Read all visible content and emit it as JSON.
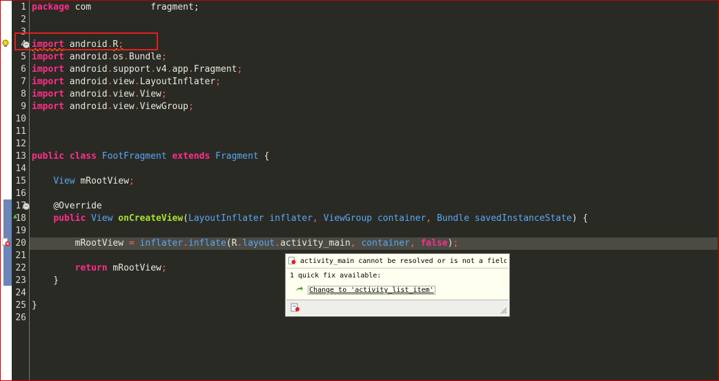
{
  "editor": {
    "lines": [
      {
        "n": "1",
        "t": [
          [
            "kw",
            "package"
          ],
          [
            "pn",
            " com"
          ],
          [
            "pn",
            "           "
          ],
          [
            "pn",
            "fragment;"
          ]
        ]
      },
      {
        "n": "2",
        "t": []
      },
      {
        "n": "3",
        "t": []
      },
      {
        "n": "4",
        "t": [
          [
            "kw",
            "import"
          ],
          [
            "pn",
            " android"
          ],
          [
            "dot",
            "."
          ],
          [
            "pn",
            "R"
          ],
          [
            "dot",
            ";"
          ]
        ]
      },
      {
        "n": "5",
        "t": [
          [
            "kw",
            "import"
          ],
          [
            "pn",
            " android"
          ],
          [
            "dot",
            "."
          ],
          [
            "pn",
            "os"
          ],
          [
            "dot",
            "."
          ],
          [
            "pn",
            "Bundle"
          ],
          [
            "dot",
            ";"
          ]
        ]
      },
      {
        "n": "6",
        "t": [
          [
            "kw",
            "import"
          ],
          [
            "pn",
            " android"
          ],
          [
            "dot",
            "."
          ],
          [
            "pn",
            "support"
          ],
          [
            "dot",
            "."
          ],
          [
            "pn",
            "v4"
          ],
          [
            "dot",
            "."
          ],
          [
            "pn",
            "app"
          ],
          [
            "dot",
            "."
          ],
          [
            "pn",
            "Fragment"
          ],
          [
            "dot",
            ";"
          ]
        ]
      },
      {
        "n": "7",
        "t": [
          [
            "kw",
            "import"
          ],
          [
            "pn",
            " android"
          ],
          [
            "dot",
            "."
          ],
          [
            "pn",
            "view"
          ],
          [
            "dot",
            "."
          ],
          [
            "pn",
            "LayoutInflater"
          ],
          [
            "dot",
            ";"
          ]
        ]
      },
      {
        "n": "8",
        "t": [
          [
            "kw",
            "import"
          ],
          [
            "pn",
            " android"
          ],
          [
            "dot",
            "."
          ],
          [
            "pn",
            "view"
          ],
          [
            "dot",
            "."
          ],
          [
            "pn",
            "View"
          ],
          [
            "dot",
            ";"
          ]
        ]
      },
      {
        "n": "9",
        "t": [
          [
            "kw",
            "import"
          ],
          [
            "pn",
            " android"
          ],
          [
            "dot",
            "."
          ],
          [
            "pn",
            "view"
          ],
          [
            "dot",
            "."
          ],
          [
            "pn",
            "ViewGroup"
          ],
          [
            "dot",
            ";"
          ]
        ]
      },
      {
        "n": "10",
        "t": []
      },
      {
        "n": "11",
        "t": []
      },
      {
        "n": "12",
        "t": []
      },
      {
        "n": "13",
        "t": [
          [
            "kw",
            "public"
          ],
          [
            "pn",
            " "
          ],
          [
            "kw",
            "class"
          ],
          [
            "pn",
            " "
          ],
          [
            "ty",
            "FootFragment"
          ],
          [
            "pn",
            " "
          ],
          [
            "kw",
            "extends"
          ],
          [
            "pn",
            " "
          ],
          [
            "ty",
            "Fragment"
          ],
          [
            "pn",
            " {"
          ]
        ]
      },
      {
        "n": "14",
        "t": []
      },
      {
        "n": "15",
        "t": [
          [
            "pn",
            "    "
          ],
          [
            "ty",
            "View"
          ],
          [
            "pn",
            " mRootView"
          ],
          [
            "dot",
            ";"
          ]
        ]
      },
      {
        "n": "16",
        "t": []
      },
      {
        "n": "17",
        "t": [
          [
            "pn",
            "    "
          ],
          [
            "an",
            "@Override"
          ]
        ]
      },
      {
        "n": "18",
        "t": [
          [
            "pn",
            "    "
          ],
          [
            "kw",
            "public"
          ],
          [
            "pn",
            " "
          ],
          [
            "ty",
            "View"
          ],
          [
            "pn",
            " "
          ],
          [
            "fn",
            "onCreateView"
          ],
          [
            "pn",
            "("
          ],
          [
            "ty",
            "LayoutInflater"
          ],
          [
            "pn",
            " "
          ],
          [
            "fld",
            "inflater"
          ],
          [
            "dot",
            ","
          ],
          [
            "pn",
            " "
          ],
          [
            "ty",
            "ViewGroup"
          ],
          [
            "pn",
            " "
          ],
          [
            "fld",
            "container"
          ],
          [
            "dot",
            ","
          ],
          [
            "pn",
            " "
          ],
          [
            "ty",
            "Bundle"
          ],
          [
            "pn",
            " "
          ],
          [
            "fld",
            "savedInstanceState"
          ],
          [
            "pn",
            ") {"
          ]
        ]
      },
      {
        "n": "19",
        "t": []
      },
      {
        "n": "20",
        "t": [
          [
            "pn",
            "        mRootView "
          ],
          [
            "op",
            "="
          ],
          [
            "pn",
            " "
          ],
          [
            "fld",
            "inflater"
          ],
          [
            "dot",
            "."
          ],
          [
            "fld",
            "inflate"
          ],
          [
            "pn",
            "("
          ],
          [
            "pn",
            "R"
          ],
          [
            "dot",
            "."
          ],
          [
            "fld",
            "layout"
          ],
          [
            "dot",
            "."
          ],
          [
            "pn",
            "activity_main"
          ],
          [
            "dot",
            ","
          ],
          [
            "pn",
            " "
          ],
          [
            "fld",
            "container"
          ],
          [
            "dot",
            ","
          ],
          [
            "pn",
            " "
          ],
          [
            "kw",
            "false"
          ],
          [
            "pn",
            ")"
          ],
          [
            "dot",
            ";"
          ]
        ]
      },
      {
        "n": "21",
        "t": []
      },
      {
        "n": "22",
        "t": [
          [
            "pn",
            "        "
          ],
          [
            "kw",
            "return"
          ],
          [
            "pn",
            " mRootView"
          ],
          [
            "dot",
            ";"
          ]
        ]
      },
      {
        "n": "23",
        "t": [
          [
            "pn",
            "    }"
          ]
        ]
      },
      {
        "n": "24",
        "t": []
      },
      {
        "n": "25",
        "t": [
          [
            "pn",
            "}"
          ]
        ]
      },
      {
        "n": "26",
        "t": []
      }
    ]
  },
  "popup": {
    "error_text": "activity_main cannot be resolved or is not a field",
    "quick_fix_label": "1 quick fix available:",
    "fix_text": "Change to 'activity_list_item'"
  },
  "colors": {
    "background": "#2a2a25",
    "keyword": "#ff2e8a",
    "type": "#58a8f5",
    "method": "#a6e22e",
    "error_box": "#e02020"
  }
}
